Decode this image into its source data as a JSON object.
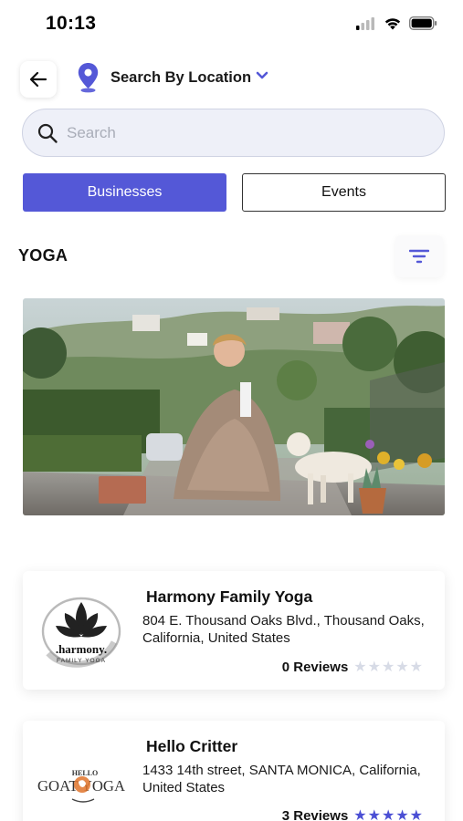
{
  "status_bar": {
    "time": "10:13"
  },
  "header": {
    "back_icon": "arrow-left-icon",
    "location_icon": "location-pin-icon",
    "title": "Search By Location",
    "dropdown_icon": "chevron-down-icon"
  },
  "search": {
    "placeholder": "Search",
    "value": ""
  },
  "tabs": [
    {
      "label": "Businesses",
      "active": true
    },
    {
      "label": "Events",
      "active": false
    }
  ],
  "section": {
    "title": "YOGA",
    "filter_icon": "filter-icon"
  },
  "colors": {
    "accent": "#5458d7",
    "star_on": "#4b4fd4",
    "star_off": "#d7dbe6"
  },
  "listings": [
    {
      "name": "Harmony Family Yoga",
      "address": "804 E. Thousand Oaks Blvd., Thousand Oaks, California, United States",
      "reviews": "0 Reviews",
      "rating": 0,
      "logo_text": ".harmony.",
      "logo_subtext": "FAMILY YOGA"
    },
    {
      "name": "Hello Critter",
      "address": "1433 14th street, SANTA MONICA, California, United States",
      "reviews": "3 Reviews",
      "rating": 5,
      "logo_text": "GOAT YOGA",
      "logo_subtext": "HELLO"
    }
  ]
}
